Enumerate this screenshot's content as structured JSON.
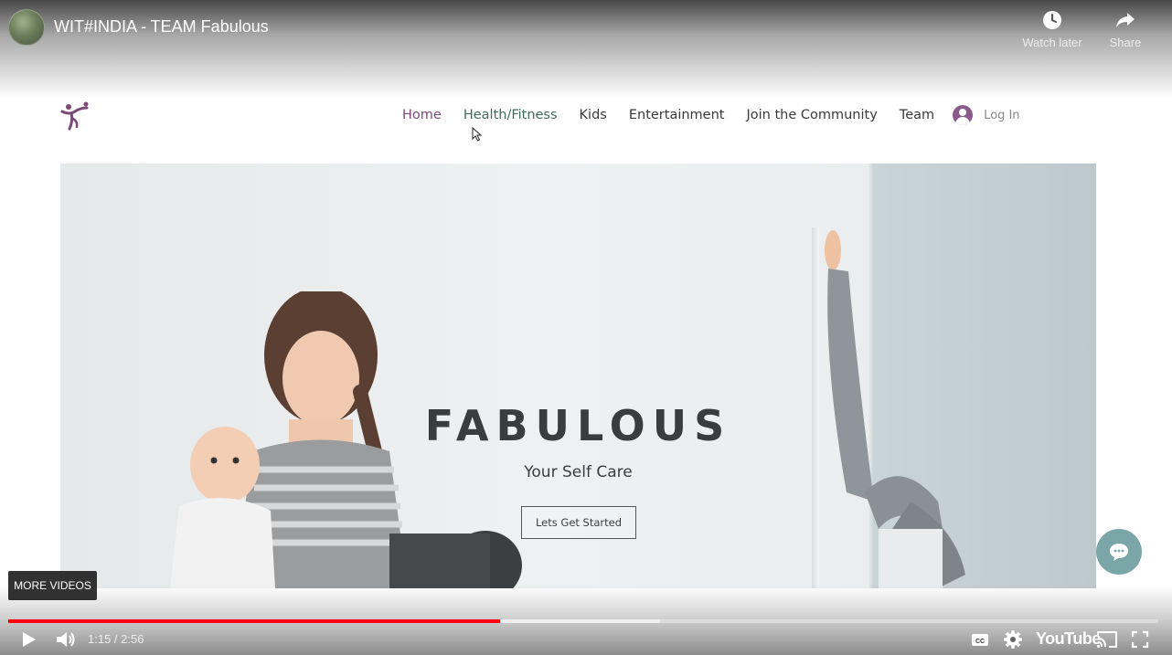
{
  "video": {
    "title": "WIT#INDIA - TEAM Fabulous",
    "watch_later_label": "Watch later",
    "share_label": "Share",
    "more_videos_label": "MORE VIDEOS",
    "time_display": "1:15 / 2:56",
    "progress_played": 0.428,
    "progress_buffered": 0.567,
    "youtube_brand": "YouTube"
  },
  "site": {
    "nav": {
      "items": [
        {
          "label": "Home"
        },
        {
          "label": "Health/Fitness"
        },
        {
          "label": "Kids"
        },
        {
          "label": "Entertainment"
        },
        {
          "label": "Join the Community"
        },
        {
          "label": "Team"
        }
      ],
      "login_label": "Log In"
    },
    "hero": {
      "title": "FABULOUS",
      "subtitle": "Your Self Care",
      "button_label": "Lets Get Started"
    }
  },
  "colors": {
    "accent_purple": "#7b4a78",
    "accent_green": "#3f6b5d",
    "progress_red": "#ff0000",
    "chat_teal": "#7aa6a8"
  },
  "icons": [
    "watch-later-icon",
    "share-icon",
    "play-icon",
    "volume-icon",
    "captions-icon",
    "settings-icon",
    "cast-icon",
    "fullscreen-icon",
    "chat-icon",
    "user-icon",
    "site-logo"
  ]
}
